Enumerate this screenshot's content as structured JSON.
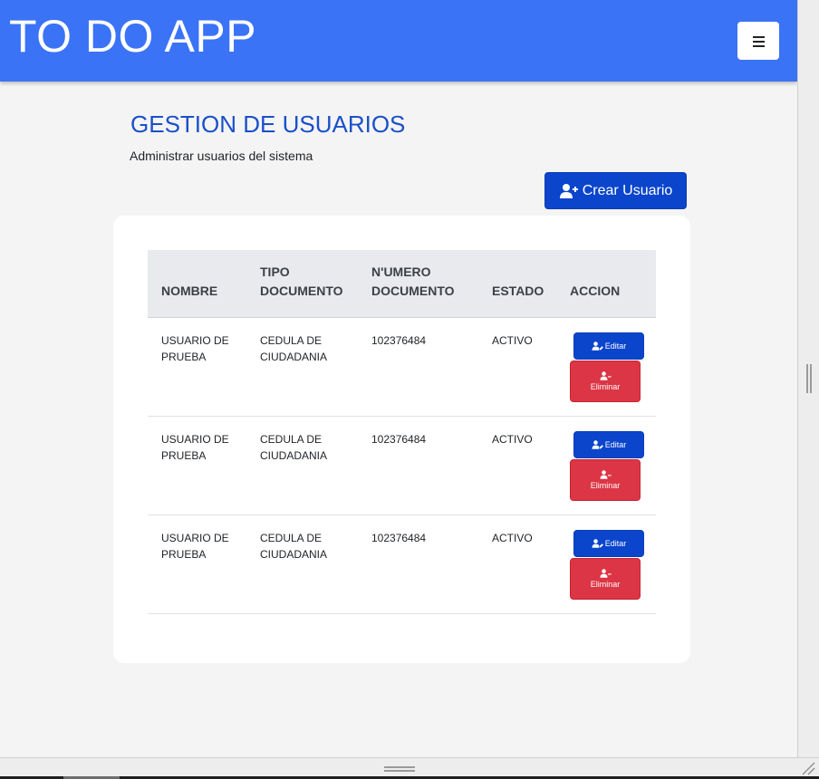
{
  "app": {
    "brand": "TO DO APP"
  },
  "header": {
    "menu_icon": "hamburger-icon"
  },
  "page": {
    "title": "GESTION DE USUARIOS",
    "subtitle": "Administrar usuarios del sistema",
    "create_button": "Crear Usuario",
    "create_icon": "user-plus-icon"
  },
  "table": {
    "columns": [
      "NOMBRE",
      "TIPO DOCUMENTO",
      "N'UMERO DOCUMENTO",
      "ESTADO",
      "ACCION"
    ],
    "rows": [
      {
        "nombre": "USUARIO DE PRUEBA",
        "tipo": "CEDULA DE CIUDADANIA",
        "numero": "102376484",
        "estado": "ACTIVO"
      },
      {
        "nombre": "USUARIO DE PRUEBA",
        "tipo": "CEDULA DE CIUDADANIA",
        "numero": "102376484",
        "estado": "ACTIVO"
      },
      {
        "nombre": "USUARIO DE PRUEBA",
        "tipo": "CEDULA DE CIUDADANIA",
        "numero": "102376484",
        "estado": "ACTIVO"
      }
    ],
    "edit_label": "Editar",
    "edit_icon": "user-edit-icon",
    "delete_label": "Eliminar",
    "delete_icon": "user-minus-icon"
  },
  "colors": {
    "navbar": "#3b73f7",
    "primary": "#0b45cc",
    "danger": "#dc3545",
    "title": "#1a50c9"
  }
}
